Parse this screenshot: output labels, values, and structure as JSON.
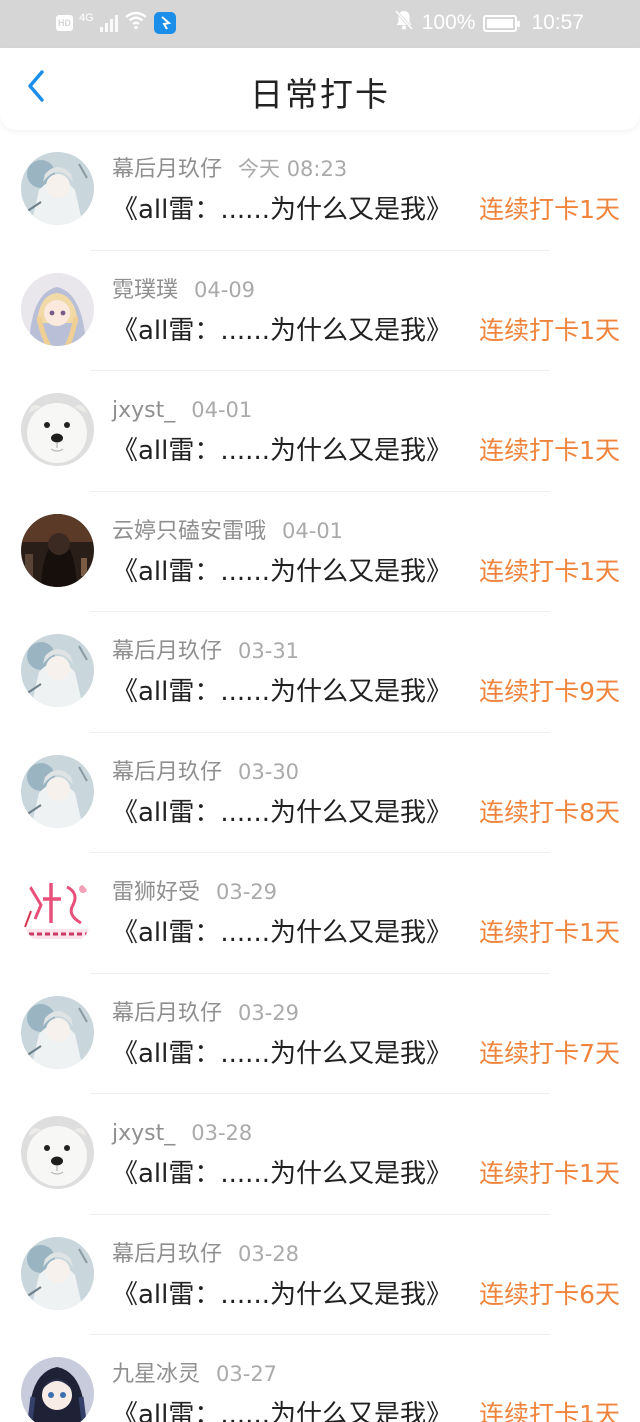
{
  "status_bar": {
    "hd": "HD",
    "network": "4G",
    "battery": "100%",
    "time": "10:57",
    "icons": [
      "hd-icon",
      "signal-icon",
      "wifi-icon",
      "app-notification-icon",
      "mute-icon",
      "battery-icon"
    ]
  },
  "header": {
    "title": "日常打卡",
    "back_icon": "chevron-left-icon"
  },
  "colors": {
    "accent": "#1a8ee8",
    "streak": "#f0843c",
    "status_bar_bg": "#d6d6d6"
  },
  "entries": [
    {
      "name": "幕后月玖仔",
      "date": "今天 08:23",
      "content": "《all雷：......为什么又是我》",
      "streak": "连续打卡1天",
      "avatar": "avatar-anime-pale"
    },
    {
      "name": "霓璞璞",
      "date": "04-09",
      "content": "《all雷：......为什么又是我》",
      "streak": "连续打卡1天",
      "avatar": "avatar-anime-blonde"
    },
    {
      "name": "jxyst_",
      "date": "04-01",
      "content": "《all雷：......为什么又是我》",
      "streak": "连续打卡1天",
      "avatar": "avatar-white-dog"
    },
    {
      "name": "云婷只磕安雷哦",
      "date": "04-01",
      "content": "《all雷：......为什么又是我》",
      "streak": "连续打卡1天",
      "avatar": "avatar-dark-figure"
    },
    {
      "name": "幕后月玖仔",
      "date": "03-31",
      "content": "《all雷：......为什么又是我》",
      "streak": "连续打卡9天",
      "avatar": "avatar-anime-pale"
    },
    {
      "name": "幕后月玖仔",
      "date": "03-30",
      "content": "《all雷：......为什么又是我》",
      "streak": "连续打卡8天",
      "avatar": "avatar-anime-pale"
    },
    {
      "name": "雷狮好受",
      "date": "03-29",
      "content": "《all雷：......为什么又是我》",
      "streak": "连续打卡1天",
      "avatar": "avatar-pink-text"
    },
    {
      "name": "幕后月玖仔",
      "date": "03-29",
      "content": "《all雷：......为什么又是我》",
      "streak": "连续打卡7天",
      "avatar": "avatar-anime-pale"
    },
    {
      "name": "jxyst_",
      "date": "03-28",
      "content": "《all雷：......为什么又是我》",
      "streak": "连续打卡1天",
      "avatar": "avatar-white-dog"
    },
    {
      "name": "幕后月玖仔",
      "date": "03-28",
      "content": "《all雷：......为什么又是我》",
      "streak": "连续打卡6天",
      "avatar": "avatar-anime-pale"
    },
    {
      "name": "九星冰灵",
      "date": "03-27",
      "content": "《all雷：......为什么又是我》",
      "streak": "连续打卡1天",
      "avatar": "avatar-anime-dark-hair"
    }
  ]
}
